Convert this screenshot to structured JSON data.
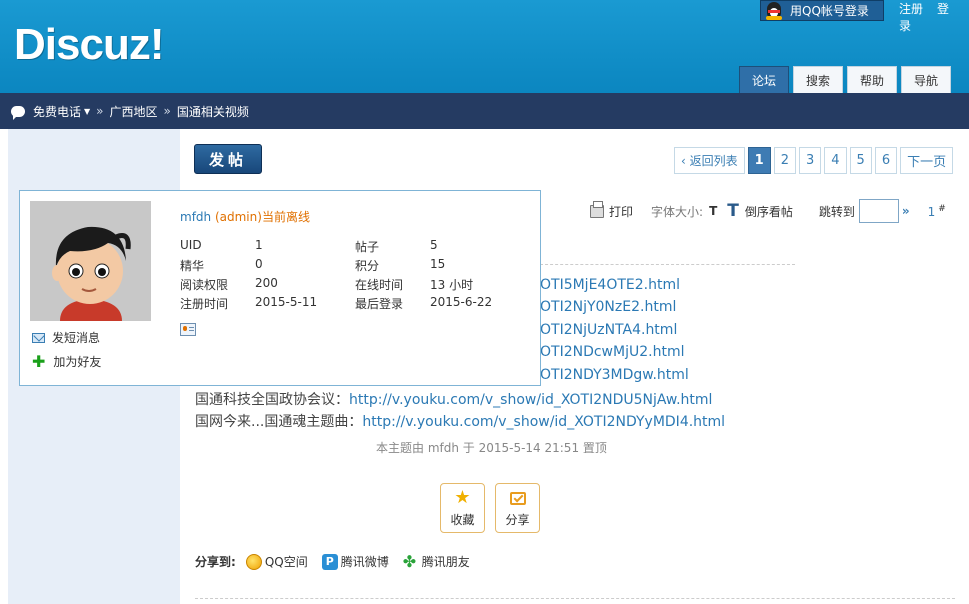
{
  "header": {
    "logo": "Discuz!",
    "qq_login": "用QQ帐号登录",
    "register": "注册",
    "login": "登录",
    "nav_tabs": [
      "论坛",
      "搜索",
      "帮助",
      "导航"
    ],
    "active_tab": "论坛"
  },
  "breadcrumb": {
    "items": [
      "免费电话",
      "广西地区",
      "国通相关视频"
    ]
  },
  "post_button": "发帖",
  "pager": {
    "back": "返回列表",
    "pages": [
      "1",
      "2",
      "3",
      "4",
      "5",
      "6"
    ],
    "current": "1",
    "next": "下一页"
  },
  "toolbar": {
    "print": "打印",
    "font_size": "字体大小:",
    "small_t": "T",
    "big_t": "T",
    "reverse": "倒序看帖",
    "jump": "跳转到",
    "jump_arrow": "»",
    "floor": "1",
    "floor_sup": "#"
  },
  "post_lines": [
    {
      "text": "",
      "url": "OTI5MjE4OTE2.html"
    },
    {
      "text": "",
      "url": "OTI2NjY0NzE2.html"
    },
    {
      "text": "",
      "url": "OTI2NjUzNTA4.html"
    },
    {
      "text": "",
      "url": "OTI2NDcwMjU2.html"
    },
    {
      "text": "",
      "url": "OTI2NDY3MDgw.html"
    },
    {
      "text": "国通科技全国政协会议：",
      "url": "http://v.youku.com/v_show/id_XOTI2NDU5NjAw.html"
    },
    {
      "text": "国网今来...国通魂主题曲：",
      "url": "http://v.youku.com/v_show/id_XOTI2NDYyMDI4.html"
    }
  ],
  "topic_note": "本主题由 mfdh 于 2015-5-14 21:51 置顶",
  "actions": {
    "favorite": "收藏",
    "share": "分享"
  },
  "share_to": {
    "label": "分享到:",
    "qzone": "QQ空间",
    "weibo": "腾讯微博",
    "friends": "腾讯朋友"
  },
  "profile_card": {
    "username": "mfdh",
    "role": "(admin)",
    "status": "当前离线",
    "fields": [
      {
        "label": "UID",
        "value": "1",
        "label2": "帖子",
        "value2": "5"
      },
      {
        "label": "精华",
        "value": "0",
        "label2": "积分",
        "value2": "15"
      },
      {
        "label": "阅读权限",
        "value": "200",
        "label2": "在线时间",
        "value2": "13 小时"
      },
      {
        "label": "注册时间",
        "value": "2015-5-11",
        "label2": "最后登录",
        "value2": "2015-6-22"
      }
    ],
    "send_message": "发短消息",
    "add_friend": "加为好友"
  },
  "colors": {
    "header_blue": "#0b86c0",
    "crumb_bar": "#253b62",
    "link": "#2b79b4",
    "accent_orange": "#e07000"
  }
}
